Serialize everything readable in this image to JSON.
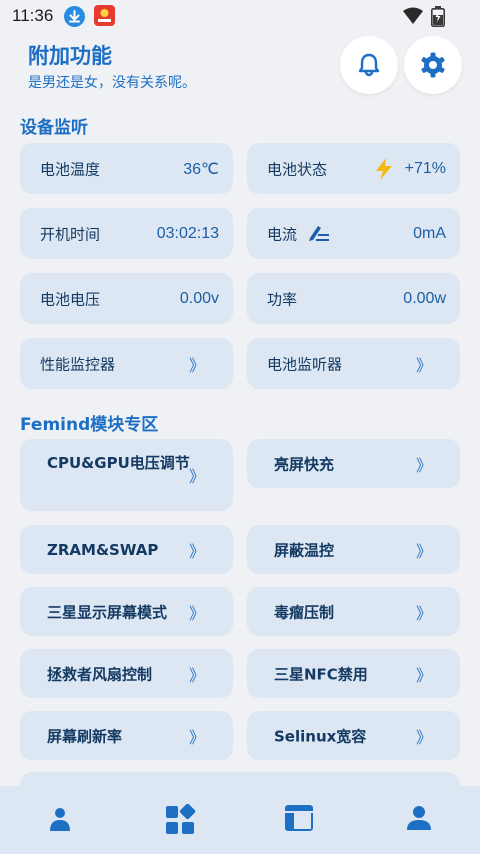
{
  "status": {
    "time": "11:36"
  },
  "header": {
    "title": "附加功能",
    "subtitle": "是男还是女，没有关系呢。"
  },
  "device_monitor": {
    "title": "设备监听",
    "items": [
      {
        "label": "电池温度",
        "value": "36℃"
      },
      {
        "label": "电池状态",
        "value": "+71%",
        "icon": "lightning-icon"
      },
      {
        "label": "开机时间",
        "value": "03:02:13"
      },
      {
        "label": "电流",
        "value": "0mA",
        "icon": "edit-sort-icon"
      },
      {
        "label": "电池电压",
        "value": "0.00v"
      },
      {
        "label": "功率",
        "value": "0.00w"
      },
      {
        "label": "性能监控器",
        "value": "》"
      },
      {
        "label": "电池监听器",
        "value": "》"
      }
    ]
  },
  "femind": {
    "title": "Femind模块专区",
    "items": [
      {
        "label": "CPU&GPU电压调节",
        "chevron": "》"
      },
      {
        "label": "亮屏快充",
        "chevron": "》"
      },
      {
        "label": "ZRAM&SWAP",
        "chevron": "》"
      },
      {
        "label": "屏蔽温控",
        "chevron": "》"
      },
      {
        "label": "三星显示屏幕模式",
        "chevron": "》"
      },
      {
        "label": "毒瘤压制",
        "chevron": "》"
      },
      {
        "label": "拯救者风扇控制",
        "chevron": "》"
      },
      {
        "label": "三星NFC禁用",
        "chevron": "》"
      },
      {
        "label": "屏幕刷新率",
        "chevron": "》"
      },
      {
        "label": "Selinux宽容",
        "chevron": "》"
      }
    ]
  },
  "bottom_nav": {
    "items": [
      {
        "icon": "person-badge-icon"
      },
      {
        "icon": "widgets-icon"
      },
      {
        "icon": "table-icon"
      },
      {
        "icon": "person-icon"
      }
    ]
  },
  "colors": {
    "accent": "#1d6fc4",
    "card": "#dce7f3",
    "background": "#eff1f5",
    "bolt": "#f5b80f"
  }
}
